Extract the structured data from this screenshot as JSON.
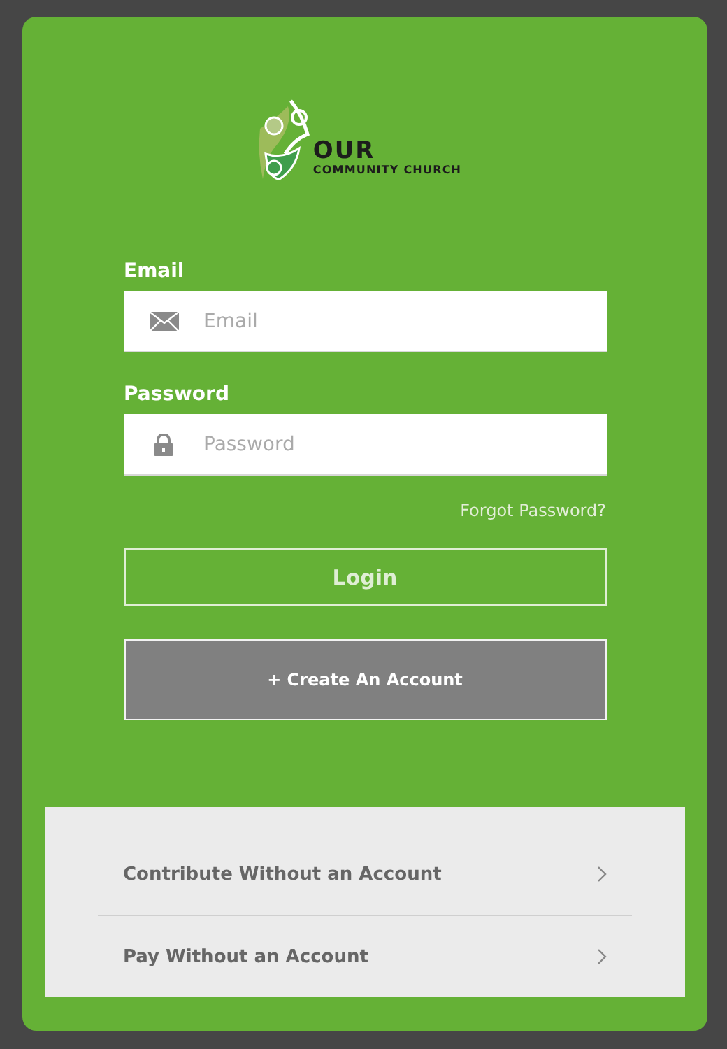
{
  "logo": {
    "line_1": "OUR",
    "line_2": "COMMUNITY CHURCH"
  },
  "fields": [
    {
      "kind": "email",
      "label": "Email",
      "placeholder": "Email"
    },
    {
      "kind": "password",
      "label": "Password",
      "placeholder": "Password"
    }
  ],
  "forgot_link": "Forgot Password?",
  "login_button": "Login",
  "create_button": "+ Create An Account",
  "guest_links": [
    "Contribute Without an Account",
    "Pay Without an Account"
  ]
}
